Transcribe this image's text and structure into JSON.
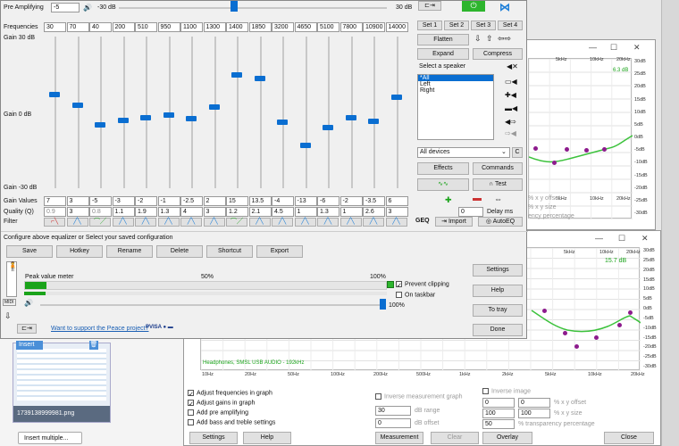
{
  "main": {
    "pre_amplifying_label": "Pre Amplifying",
    "pre_amp_value": "-5",
    "pre_amp_db": "-30 dB",
    "pre_amp_max_db": "30 dB",
    "frequencies_label": "Frequencies",
    "frequencies": [
      "30",
      "70",
      "40",
      "200",
      "510",
      "950",
      "1100",
      "1300",
      "1400",
      "1850",
      "3200",
      "4650",
      "5100",
      "7800",
      "10900",
      "14000"
    ],
    "gain_top": "Gain 30 dB",
    "gain_mid": "Gain 0 dB",
    "gain_bottom": "Gain -30 dB",
    "gain_values_label": "Gain Values",
    "gain_values": [
      "7",
      "3",
      "-5",
      "-3",
      "-2",
      "-1",
      "-2.5",
      "2",
      "15",
      "13.5",
      "-4",
      "-13",
      "-6",
      "-2",
      "-3.5",
      "6"
    ],
    "quality_label": "Quality (Q)",
    "quality_values": [
      "0.9",
      "3",
      "0.8",
      "1.1",
      "1.9",
      "1.3",
      "4",
      "3",
      "1.2",
      "2.1",
      "4.5",
      "1",
      "1.3",
      "1",
      "2.6",
      "3"
    ],
    "filter_label": "Filter",
    "gain_levels": [
      7,
      3,
      -5,
      -3,
      -2,
      -1,
      -2.5,
      2,
      15,
      13.5,
      -4,
      -13,
      -6,
      -2,
      -3.5,
      6
    ],
    "sets": [
      "Set 1",
      "Set 2",
      "Set 3",
      "Set 4"
    ],
    "flatten": "Flatten",
    "expand": "Expand",
    "compress": "Compress",
    "select_speaker": "Select a speaker",
    "speakers": [
      "*All",
      "Left",
      "Right"
    ],
    "all_devices": "All devices",
    "devices_c": "C",
    "effects": "Effects",
    "commands": "Commands",
    "test": "Test",
    "delay_value": "0",
    "delay_label": "Delay ms",
    "geq": "GEQ",
    "import": "Import",
    "autoeq": "AutoEQ",
    "configure_text": "Configure above equalizer or Select your saved configuration",
    "bottom_buttons": [
      "Save",
      "Hotkey",
      "Rename",
      "Delete",
      "Shortcut",
      "Export"
    ],
    "peak_label": "Peak value meter",
    "peak_50": "50%",
    "peak_100": "100%",
    "prevent_clipping": "Prevent clipping",
    "on_taskbar": "On taskbar",
    "volume_pct": "100%",
    "midi": "MIDI",
    "support_link": "Want to support the Peace project?",
    "side_buttons": [
      "Settings",
      "Help",
      "To tray",
      "Done"
    ],
    "colors": {
      "accent": "#0a6ed1",
      "power": "#2db52d",
      "meter": "#1aa31a"
    }
  },
  "graph_top": {
    "x_labels": [
      "5kHz",
      "10kHz",
      "20kHz"
    ],
    "y_labels": [
      "30dB",
      "25dB",
      "20dB",
      "15dB",
      "10dB",
      "5dB",
      "0dB",
      "-5dB",
      "-10dB",
      "-15dB",
      "-20dB",
      "-25dB",
      "-30dB"
    ],
    "gain_readout": "6.3 dB",
    "opt1": "% x y offset",
    "opt2": "% x y size",
    "opt3": "ency percentage"
  },
  "graph_bottom": {
    "x_labels": [
      "10Hz",
      "20Hz",
      "50Hz",
      "100Hz",
      "200Hz",
      "500Hz",
      "1kHz",
      "2kHz",
      "5kHz",
      "10kHz",
      "20kHz"
    ],
    "top_x_labels": [
      "5kHz",
      "10kHz",
      "20kHz"
    ],
    "y_labels": [
      "30dB",
      "25dB",
      "20dB",
      "15dB",
      "10dB",
      "5dB",
      "0dB",
      "-5dB",
      "-10dB",
      "-15dB",
      "-20dB",
      "-25dB",
      "-30dB"
    ],
    "gain_readout": "15.7 dB",
    "device": "Headphones, SMSL USB AUDIO - 192kHz",
    "checks": [
      {
        "label": "Adjust frequencies in graph",
        "checked": true
      },
      {
        "label": "Adjust gains in graph",
        "checked": true
      },
      {
        "label": "Add pre amplifying",
        "checked": false
      },
      {
        "label": "Add bass and treble settings",
        "checked": false
      }
    ],
    "inverse_measure": "Inverse measurement graph",
    "db_range_val": "30",
    "db_range": "dB range",
    "db_offset_val": "0",
    "db_offset": "dB offset",
    "inverse_image": "Inverse image",
    "xy_off_1": "0",
    "xy_off_2": "0",
    "xy_offset": "% x y offset",
    "xy_size_1": "100",
    "xy_size_2": "100",
    "xy_size": "% x y size",
    "transp_val": "50",
    "transparency": "% transparency percentage",
    "buttons": [
      "Settings",
      "Help",
      "Measurement",
      "Clear",
      "Overlay",
      "Close"
    ]
  },
  "background": {
    "insert_label": "Insert",
    "file_name": "1739138999981.png",
    "insert_multiple": "Insert multiple..."
  }
}
